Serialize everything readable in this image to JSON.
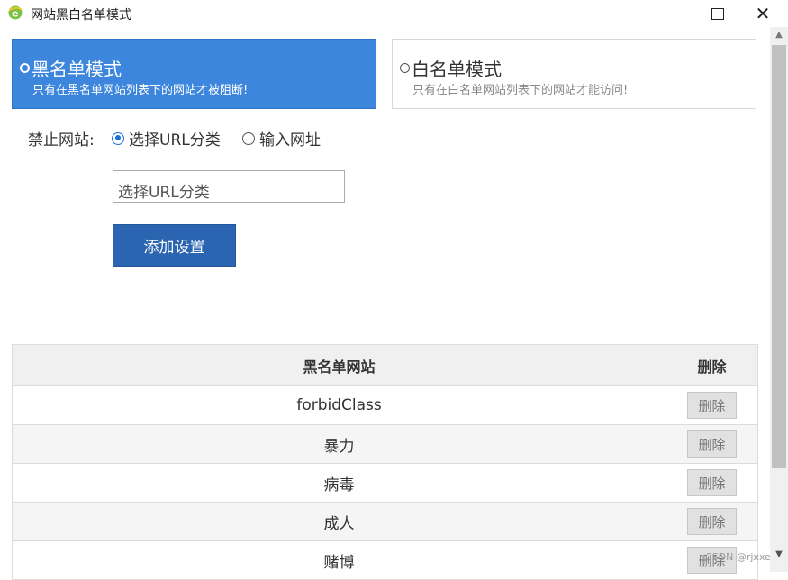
{
  "window": {
    "title": "网站黑白名单模式",
    "icon": "ie-logo-icon"
  },
  "modes": {
    "blacklist": {
      "title": "黑名单模式",
      "desc": "只有在黑名单网站列表下的网站才被阻断!",
      "selected": true,
      "color": "#3d86de"
    },
    "whitelist": {
      "title": "白名单模式",
      "desc": "只有在白名单网站列表下的网站才能访问!",
      "selected": false
    }
  },
  "forbid": {
    "label": "禁止网站:",
    "option_url": "选择URL分类",
    "option_input": "输入网址",
    "selected": "option_url"
  },
  "select": {
    "value": "选择URL分类"
  },
  "add_button": {
    "label": "添加设置",
    "color": "#2b65b2"
  },
  "table": {
    "headers": {
      "site": "黑名单网站",
      "delete": "删除"
    },
    "rows": [
      {
        "site": "forbidClass",
        "delete": "删除"
      },
      {
        "site": "暴力",
        "delete": "删除"
      },
      {
        "site": "病毒",
        "delete": "删除"
      },
      {
        "site": "成人",
        "delete": "删除"
      },
      {
        "site": "赌博",
        "delete": "删除"
      }
    ]
  },
  "watermark": "CSDN @rjxxer"
}
